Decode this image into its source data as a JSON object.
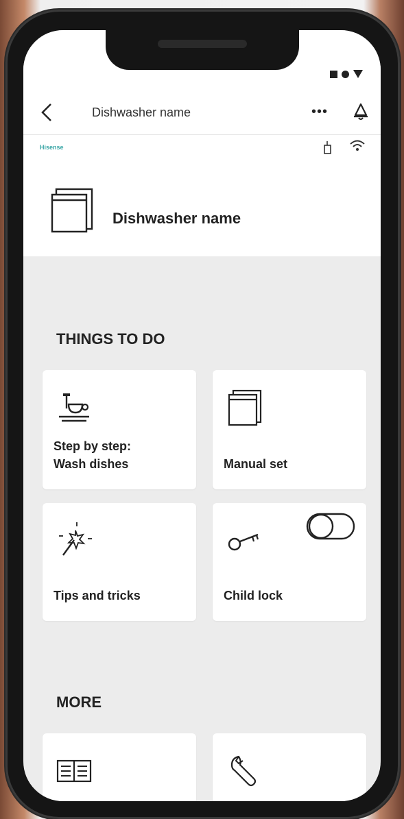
{
  "app": {
    "title": "Dishwasher name",
    "more_label": "•••",
    "brand": "Hisense"
  },
  "device": {
    "name": "Dishwasher name"
  },
  "sections": {
    "things_to_do": "THINGS TO DO",
    "more": "MORE"
  },
  "cards": {
    "step_by_step": {
      "line1": "Step by step:",
      "line2": "Wash dishes",
      "icon": "dish-icon"
    },
    "manual_set": {
      "label": "Manual set",
      "icon": "dishwasher-icon"
    },
    "tips": {
      "label": "Tips and tricks",
      "icon": "magic-wand-icon"
    },
    "child_lock": {
      "label": "Child lock",
      "icon": "key-icon",
      "toggle_on": false
    },
    "manual": {
      "icon": "book-icon"
    },
    "service": {
      "icon": "wrench-icon"
    }
  },
  "colors": {
    "brand": "#3aa6a6",
    "background": "#ececec",
    "card": "#ffffff"
  }
}
